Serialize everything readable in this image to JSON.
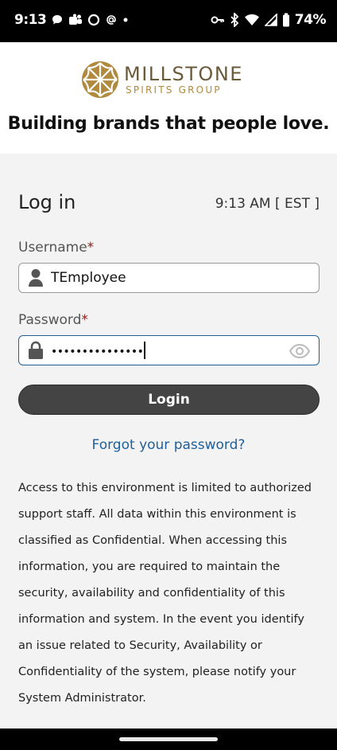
{
  "status_bar": {
    "time": "9:13",
    "battery": "74%",
    "left_icons": [
      "chat-bubble-icon",
      "teams-icon",
      "circle-icon",
      "at-sign-icon",
      "dot-icon"
    ],
    "right_icons": [
      "key-icon",
      "bluetooth-icon",
      "wifi-icon",
      "signal-icon",
      "battery-icon"
    ]
  },
  "header": {
    "brand_name": "MILLSTONE",
    "brand_sub": "SPIRITS GROUP",
    "tagline": "Building brands that people love.",
    "brand_color": "#b08a3e"
  },
  "login": {
    "title": "Log in",
    "server_time": "9:13 AM [ EST ]",
    "username_label": "Username",
    "username_value": "TEmployee",
    "password_label": "Password",
    "password_value": "•••••••••••••••",
    "required_marker": "*",
    "login_button": "Login",
    "forgot_link": "Forgot your password?",
    "notice": "Access to this environment is limited to authorized support staff. All data within this environment is classified as Confidential. When accessing this information, you are required to maintain the security, availability and confidentiality of this information and system. In the event you identify an issue related to Security, Availability or Confidentiality of the system, please notify your System Administrator."
  },
  "colors": {
    "link": "#1f5f9a",
    "button": "#444444",
    "required": "#8b1a1a",
    "background": "#f3f3f3"
  }
}
